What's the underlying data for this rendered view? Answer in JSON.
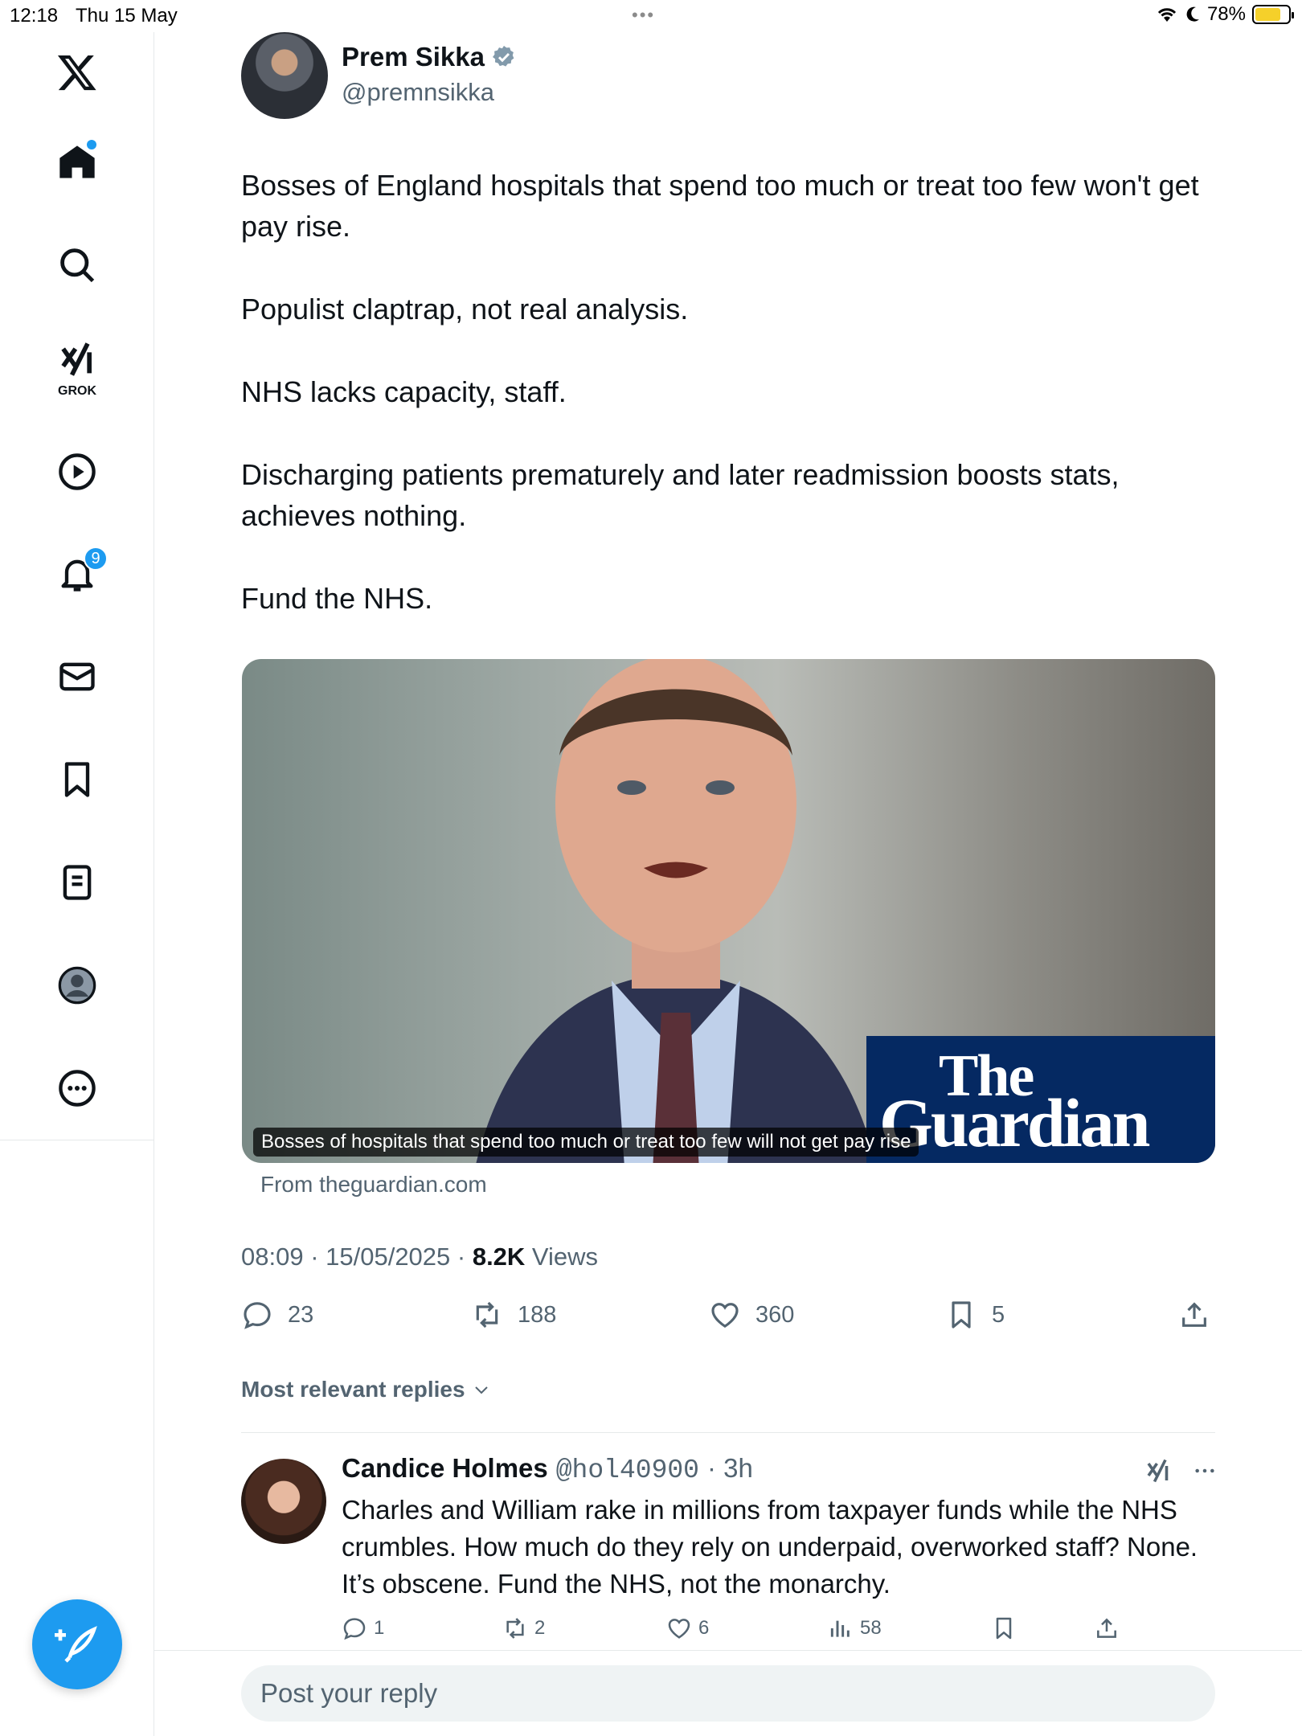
{
  "status_bar": {
    "time": "12:18",
    "date": "Thu 15 May",
    "battery": "78%"
  },
  "sidebar": {
    "grok_label": "GROK",
    "notifications_badge": "9"
  },
  "tweet": {
    "author_name": "Prem Sikka",
    "author_handle": "@premnsikka",
    "paragraphs": [
      "Bosses of England hospitals that spend too much or treat too few won't get pay rise.",
      "Populist claptrap, not real analysis.",
      "NHS lacks capacity, staff.",
      "Discharging patients prematurely and later readmission boosts stats, achieves nothing.",
      "Fund the NHS."
    ],
    "card": {
      "brand_line1": "The",
      "brand_line2": "Guardian",
      "caption": "Bosses of hospitals that spend too much or treat too few will not get pay rise",
      "source": "From theguardian.com"
    },
    "timestamp": "08:09 · 15/05/2025 · ",
    "views_count": "8.2K",
    "views_label": " Views",
    "stats": {
      "replies": "23",
      "reposts": "188",
      "likes": "360",
      "bookmarks": "5"
    }
  },
  "sort_label": "Most relevant replies",
  "reply": {
    "name": "Candice Holmes",
    "handle": "@hol40900",
    "time": "· 3h",
    "text": "Charles and William rake in millions from taxpayer funds while the NHS crumbles. How much do they rely on underpaid, overworked staff? None. It’s obscene. Fund the NHS, not the monarchy.",
    "stats": {
      "replies": "1",
      "reposts": "2",
      "likes": "6",
      "views": "58"
    }
  },
  "composer_placeholder": "Post your reply",
  "colors": {
    "accent": "#1d9bf0",
    "guardian_blue": "#052962",
    "muted": "#536471"
  }
}
